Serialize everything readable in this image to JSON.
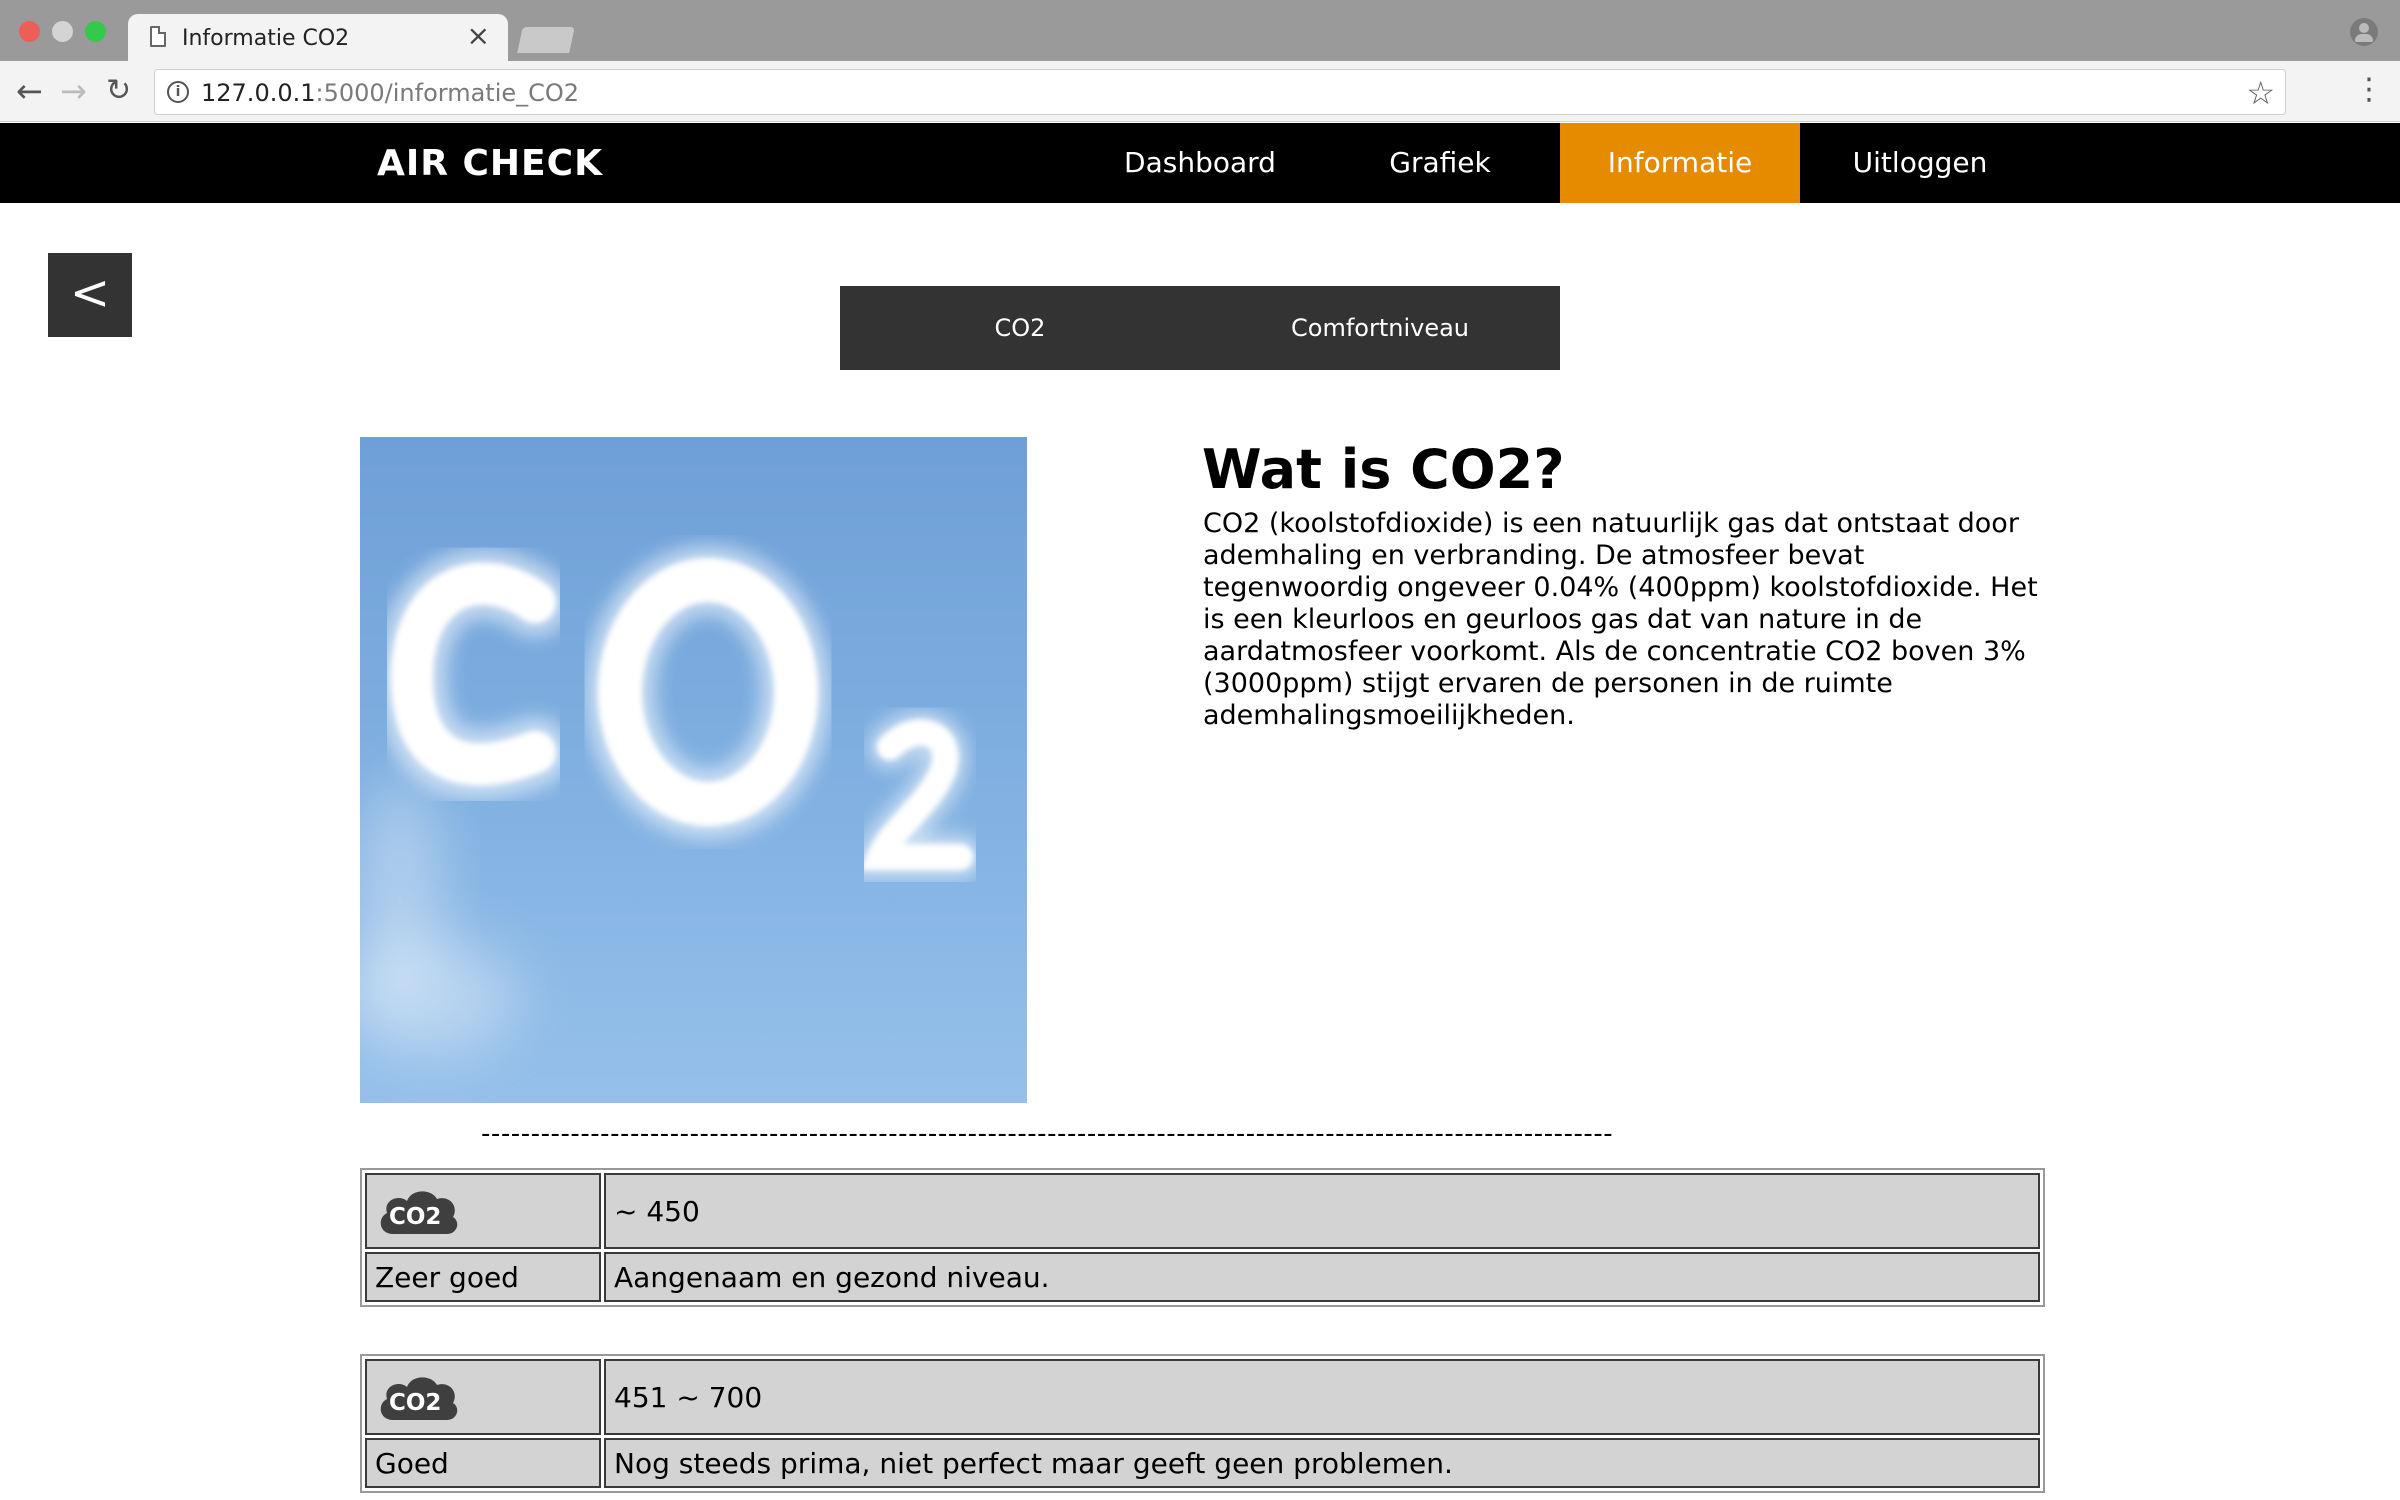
{
  "browser": {
    "tab_title": "Informatie CO2",
    "tab_close": "×",
    "url_host": "127.0.0.1",
    "url_path": ":5000/informatie_CO2",
    "back": "←",
    "forward": "→",
    "reload": "↻",
    "info": "i",
    "star": "☆",
    "menu": "⋮"
  },
  "nav": {
    "brand": "AIR CHECK",
    "links": [
      "Dashboard",
      "Grafiek",
      "Informatie",
      "Uitloggen"
    ],
    "active": "Informatie",
    "active_color": "#e68a00"
  },
  "back_button": "<",
  "subnav": {
    "tabs": [
      "CO2",
      "Comfortniveau"
    ]
  },
  "content": {
    "title": "Wat is CO2?",
    "body": "CO2 (koolstofdioxide) is een natuurlijk gas dat ontstaat door ademhaling en verbranding. De atmosfeer bevat tegenwoordig ongeveer 0.04% (400ppm) koolstofdioxide. Het is een kleurloos en geurloos gas dat van nature in de aardatmosfeer voorkomt. Als de concentratie CO2 boven 3% (3000ppm) stijgt ervaren de personen in de ruimte ademhalingsmoeilijkheden.",
    "image_text": "CO2"
  },
  "divider": "------------------------------------------------------------------------------------------------------------------",
  "levels": [
    {
      "icon": "co2-cloud-icon",
      "icon_text": "CO2",
      "range": "~ 450",
      "label": "Zeer goed",
      "description": "Aangenaam en gezond niveau."
    },
    {
      "icon": "co2-cloud-icon",
      "icon_text": "CO2",
      "range": "451 ~ 700",
      "label": "Goed",
      "description": "Nog steeds prima, niet perfect maar geeft geen problemen."
    }
  ]
}
